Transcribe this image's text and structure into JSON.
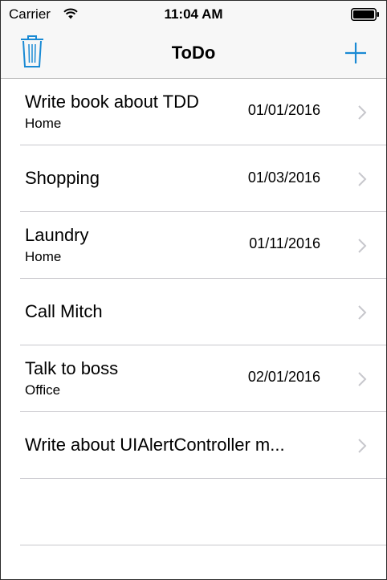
{
  "status_bar": {
    "carrier": "Carrier",
    "time": "11:04 AM",
    "wifi_icon": "wifi-icon",
    "battery_icon": "battery-icon"
  },
  "nav_bar": {
    "title": "ToDo",
    "left_icon": "trash-icon",
    "right_icon": "plus-icon",
    "accent_color": "#1a8ad4"
  },
  "todos": [
    {
      "title": "Write book about TDD",
      "location": "Home",
      "date": "01/01/2016"
    },
    {
      "title": "Shopping",
      "location": "",
      "date": "01/03/2016"
    },
    {
      "title": "Laundry",
      "location": "Home",
      "date": "01/11/2016"
    },
    {
      "title": "Call Mitch",
      "location": "",
      "date": ""
    },
    {
      "title": "Talk to boss",
      "location": "Office",
      "date": "02/01/2016"
    },
    {
      "title": "Write about UIAlertController m...",
      "location": "",
      "date": ""
    }
  ]
}
